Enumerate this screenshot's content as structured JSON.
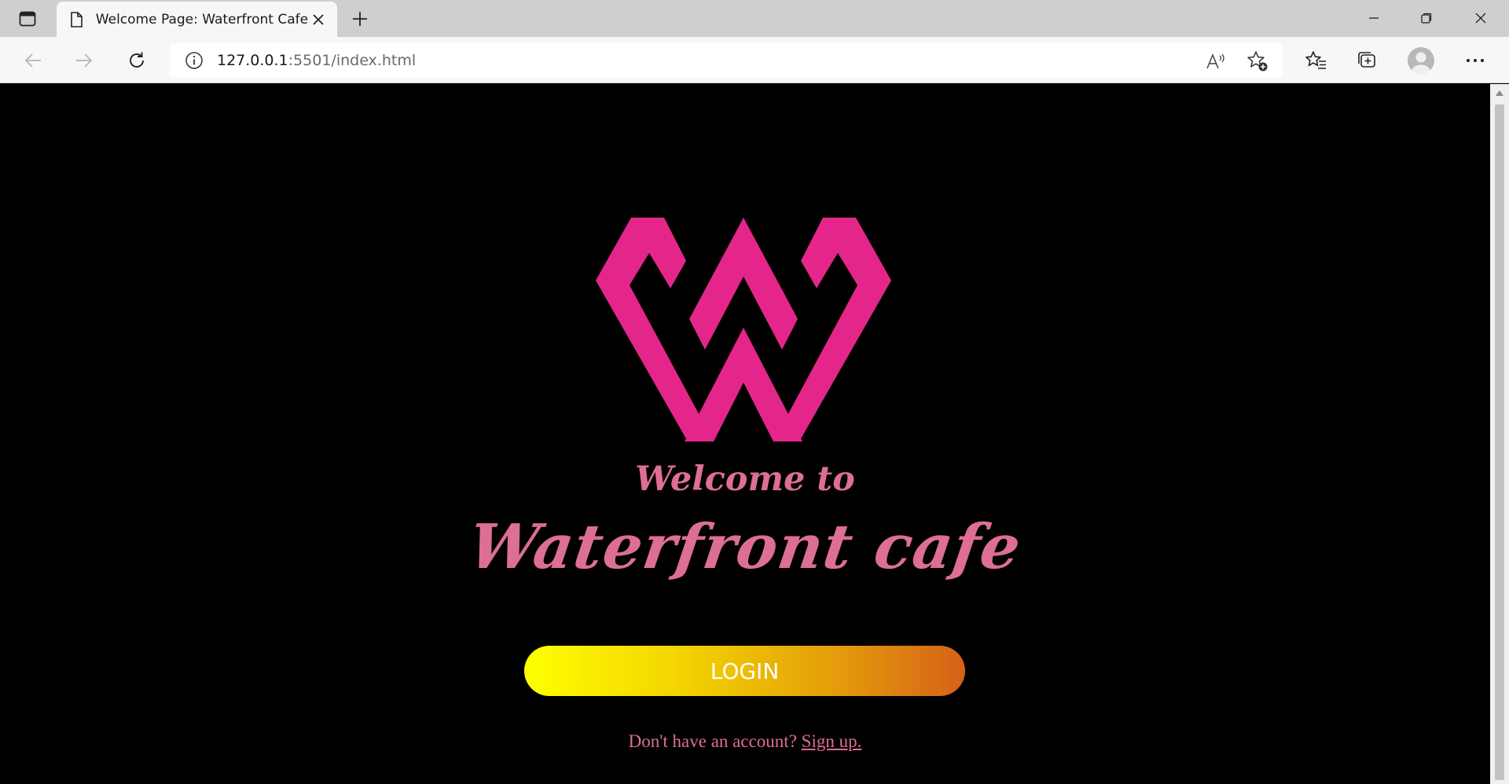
{
  "browser": {
    "tab_title": "Welcome Page: Waterfront Cafe",
    "url_host": "127.0.0.1",
    "url_rest": ":5501/index.html",
    "icons": [
      "tab-actions-icon",
      "page-icon",
      "close-icon",
      "plus-icon",
      "minimize-icon",
      "restore-icon",
      "close-window-icon",
      "back-arrow-icon",
      "forward-arrow-icon",
      "refresh-icon",
      "info-icon",
      "read-aloud-icon",
      "add-favorite-icon",
      "favorites-icon",
      "collections-icon",
      "profile-avatar-icon",
      "more-icon"
    ]
  },
  "page": {
    "welcome": "Welcome to",
    "cafe_name": "Waterfront cafe",
    "login_label": "LOGIN",
    "signup_prompt": "Don't have an account?",
    "signup_link": "Sign up."
  },
  "colors": {
    "logo": "#e4268a",
    "heading": "#dd6e95",
    "button_gradient_start": "#ffff00",
    "button_gradient_end": "#d5601a",
    "background": "#000000"
  }
}
